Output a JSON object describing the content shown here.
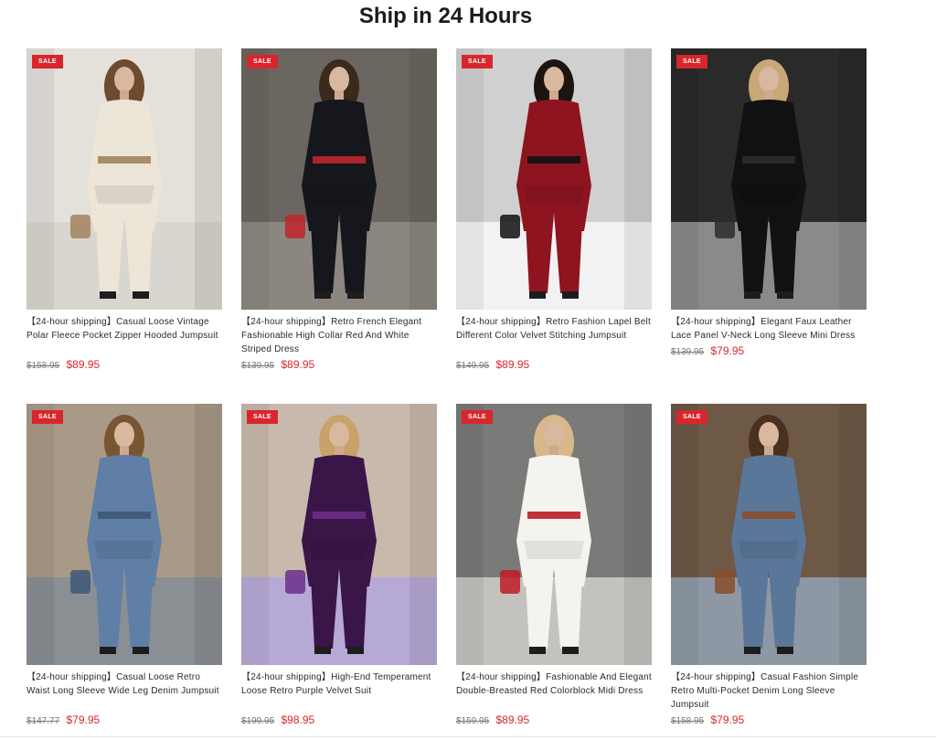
{
  "section": {
    "title": "Ship in 24 Hours"
  },
  "sale_badge": "SALE",
  "products": [
    {
      "title": "【24-hour shipping】Casual Loose Vintage Polar Fleece Pocket Zipper Hooded Jumpsuit",
      "old_price": "$158.95",
      "price": "$89.95",
      "image_icon": "model-beige-fleece-jumpsuit-image",
      "colors": {
        "bg": "#e4e0da",
        "floor": "#d9d6d0",
        "garment": "#ece5d8",
        "accent": "#a2835e",
        "hair": "#6e4a2e"
      }
    },
    {
      "title": "【24-hour shipping】Retro French Elegant Fashionable High Collar Red And White Striped Dress",
      "old_price": "$139.95",
      "price": "$89.95",
      "image_icon": "model-black-striped-dress-image",
      "colors": {
        "bg": "#6c6660",
        "floor": "#8c8680",
        "garment": "#15171c",
        "accent": "#c0262c",
        "hair": "#3a2a1e"
      }
    },
    {
      "title": "【24-hour shipping】Retro Fashion Lapel Belt Different Color Velvet Stitching Jumpsuit",
      "old_price": "$149.95",
      "price": "$89.95",
      "image_icon": "model-red-velvet-jumpsuit-image",
      "colors": {
        "bg": "#d0d0d0",
        "floor": "#f2f2f2",
        "garment": "#8e1420",
        "accent": "#111111",
        "hair": "#1c1410"
      }
    },
    {
      "title": "【24-hour shipping】Elegant Faux Leather Lace Panel V-Neck Long Sleeve Mini Dress",
      "old_price": "$139.95",
      "price": "$79.95",
      "image_icon": "model-black-leather-dress-image",
      "colors": {
        "bg": "#2a2a2a",
        "floor": "#8a8a8a",
        "garment": "#111111",
        "accent": "#2c2c2c",
        "hair": "#c9a878"
      }
    },
    {
      "title": "【24-hour shipping】Casual Loose Retro Waist Long Sleeve Wide Leg Denim Jumpsuit",
      "old_price": "$147.77",
      "price": "$79.95",
      "image_icon": "model-denim-wide-leg-jumpsuit-image",
      "colors": {
        "bg": "#a99a88",
        "floor": "#8a8f94",
        "garment": "#5f7fa6",
        "accent": "#3d5878",
        "hair": "#7a5534"
      }
    },
    {
      "title": "【24-hour shipping】High-End Temperament Loose Retro Purple Velvet Suit",
      "old_price": "$199.95",
      "price": "$98.95",
      "image_icon": "model-purple-velvet-suit-image",
      "colors": {
        "bg": "#c9b9ad",
        "floor": "#b7a9d6",
        "garment": "#3a1648",
        "accent": "#6b2f8a",
        "hair": "#c9a16a"
      }
    },
    {
      "title": "【24-hour shipping】Fashionable And Elegant Double-Breasted Red Colorblock Midi Dress",
      "old_price": "$159.95",
      "price": "$89.95",
      "image_icon": "model-white-double-breasted-dress-image",
      "colors": {
        "bg": "#7a7a78",
        "floor": "#c4c2be",
        "garment": "#f5f3ee",
        "accent": "#c01c24",
        "hair": "#d8b88a"
      }
    },
    {
      "title": "【24-hour shipping】Casual Fashion Simple Retro Multi-Pocket Denim Long Sleeve Jumpsuit",
      "old_price": "$158.95",
      "price": "$79.95",
      "image_icon": "model-denim-multi-pocket-jumpsuit-image",
      "colors": {
        "bg": "#6e5846",
        "floor": "#8e98a4",
        "garment": "#5a7799",
        "accent": "#8a4e2c",
        "hair": "#4a3020"
      }
    }
  ]
}
